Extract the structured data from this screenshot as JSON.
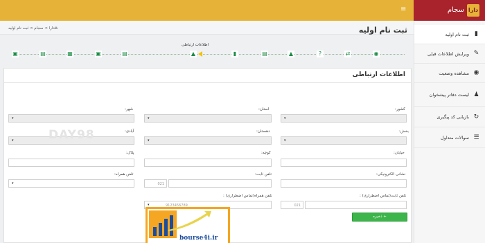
{
  "header": {
    "brand_logo": "دارا",
    "brand_name": "سجام",
    "menu_icon": "menu-icon",
    "colors": {
      "topbar": "#e6b338",
      "brand": "#a8232c",
      "accent": "#1d8c46",
      "button": "#3cb54a"
    }
  },
  "sidebar": {
    "items": [
      {
        "label": "ثبت نام اولیه",
        "icon": "file-icon"
      },
      {
        "label": "ویرایش اطلاعات قبلی",
        "icon": "edit-icon"
      },
      {
        "label": "مشاهده وضعیت",
        "icon": "eye-icon"
      },
      {
        "label": "لیست دفاتر پیشخوان",
        "icon": "user-icon"
      },
      {
        "label": "بازیابی کد پیگیری",
        "icon": "refresh-icon"
      },
      {
        "label": "سوالات متداول",
        "icon": "list-icon"
      }
    ]
  },
  "breadcrumb": {
    "text": "دارا > سجام > ثبت نام اولیه",
    "home_icon": "home-icon"
  },
  "page": {
    "title": "ثبت نام اولیه"
  },
  "steps": {
    "current_label": "اطلاعات ارتباطی",
    "icons": [
      "bank-icon",
      "card-icon",
      "list-icon",
      "factory-icon",
      "card-icon",
      "graduation-icon",
      "bookmark-icon",
      "card-icon",
      "tree-icon",
      "help-icon",
      "shuffle-icon",
      "money-icon"
    ]
  },
  "form": {
    "title": "اطلاعات ارتباطی",
    "fields": {
      "country": {
        "label": "کشور:",
        "value": "▾"
      },
      "province": {
        "label": "استان:",
        "value": "▾"
      },
      "city": {
        "label": "شهر:",
        "value": "▾"
      },
      "section": {
        "label": "بخش:",
        "value": "▾"
      },
      "village": {
        "label": "دهستان:",
        "value": "▾"
      },
      "abadi": {
        "label": "آبادی:",
        "value": "▾"
      },
      "street": {
        "label": "خیابان:"
      },
      "alley": {
        "label": "کوچه:"
      },
      "plaque": {
        "label": "پلاک:"
      },
      "email": {
        "label": "نشانی الکترونیکی:"
      },
      "phone": {
        "label": "تلفن ثابت:",
        "code": "021"
      },
      "mobile": {
        "label": "تلفن همراه:",
        "value": "▾"
      },
      "emergency_phone": {
        "label": "تلفن ثابت(تماس اضطراری) :",
        "code": "021"
      },
      "emergency_mobile": {
        "label": "تلفن همراه(تماس اضطراری) :",
        "value": "▾",
        "placeholder": "9123456789"
      }
    },
    "submit_label": "ذخیره +"
  },
  "watermark": "DAY98",
  "overlay": {
    "text": "bourse4i.ir"
  }
}
